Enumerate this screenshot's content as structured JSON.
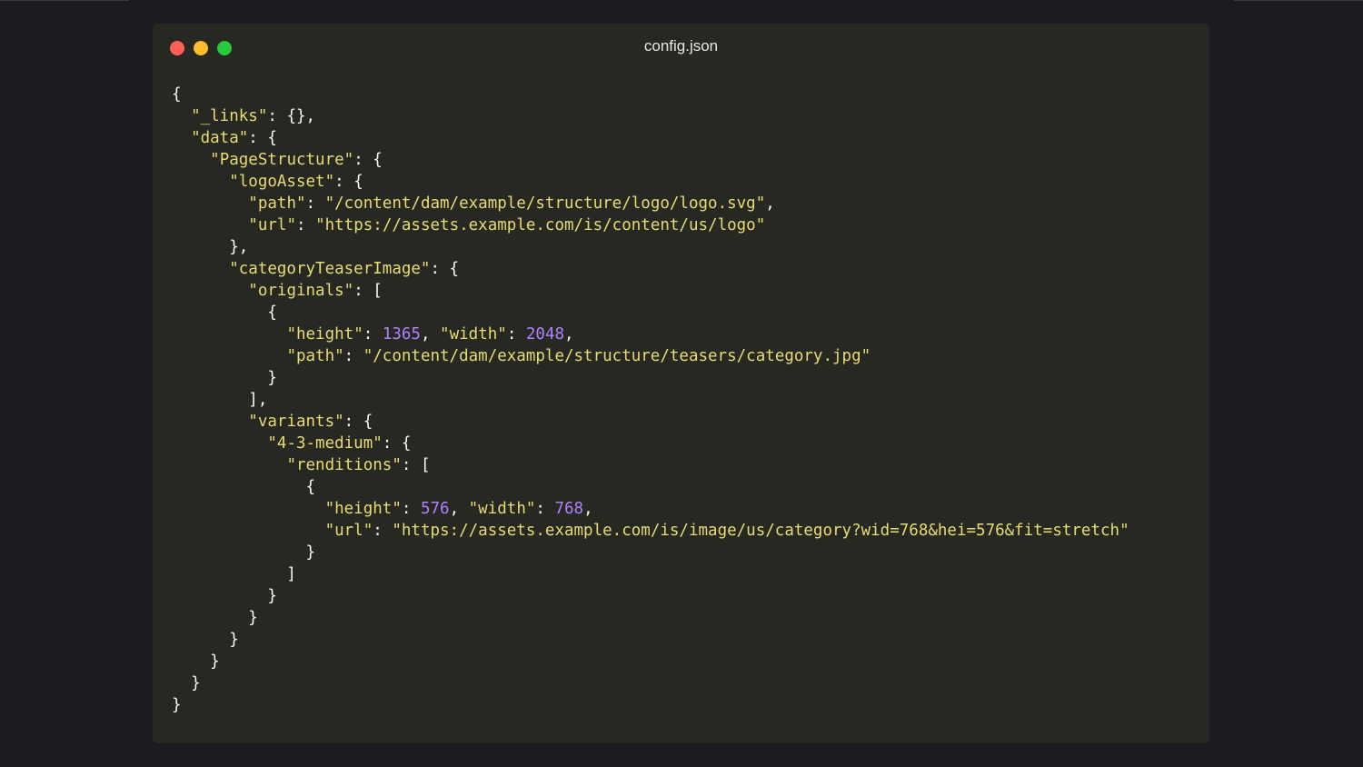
{
  "window": {
    "title": "config.json",
    "buttons": [
      "close",
      "minimize",
      "zoom"
    ]
  },
  "colors": {
    "background": "#1b1c20",
    "editor_background": "#272822",
    "text": "#f8f8f2",
    "string": "#e6db74",
    "number": "#ae81ff",
    "close": "#ff5f56",
    "minimize": "#ffbd2e",
    "zoom": "#27c93f"
  },
  "code": {
    "lines": [
      [
        {
          "t": "p",
          "v": "{"
        }
      ],
      [
        {
          "t": "p",
          "v": "  "
        },
        {
          "t": "k",
          "v": "\"_links\""
        },
        {
          "t": "p",
          "v": ": {},"
        }
      ],
      [
        {
          "t": "p",
          "v": "  "
        },
        {
          "t": "k",
          "v": "\"data\""
        },
        {
          "t": "p",
          "v": ": {"
        }
      ],
      [
        {
          "t": "p",
          "v": "    "
        },
        {
          "t": "k",
          "v": "\"PageStructure\""
        },
        {
          "t": "p",
          "v": ": {"
        }
      ],
      [
        {
          "t": "p",
          "v": "      "
        },
        {
          "t": "k",
          "v": "\"logoAsset\""
        },
        {
          "t": "p",
          "v": ": {"
        }
      ],
      [
        {
          "t": "p",
          "v": "        "
        },
        {
          "t": "k",
          "v": "\"path\""
        },
        {
          "t": "p",
          "v": ": "
        },
        {
          "t": "s",
          "v": "\"/content/dam/example/structure/logo/logo.svg\""
        },
        {
          "t": "p",
          "v": ","
        }
      ],
      [
        {
          "t": "p",
          "v": "        "
        },
        {
          "t": "k",
          "v": "\"url\""
        },
        {
          "t": "p",
          "v": ": "
        },
        {
          "t": "s",
          "v": "\"https://assets.example.com/is/content/us/logo\""
        }
      ],
      [
        {
          "t": "p",
          "v": "      },"
        }
      ],
      [
        {
          "t": "p",
          "v": "      "
        },
        {
          "t": "k",
          "v": "\"categoryTeaserImage\""
        },
        {
          "t": "p",
          "v": ": {"
        }
      ],
      [
        {
          "t": "p",
          "v": "        "
        },
        {
          "t": "k",
          "v": "\"originals\""
        },
        {
          "t": "p",
          "v": ": ["
        }
      ],
      [
        {
          "t": "p",
          "v": "          {"
        }
      ],
      [
        {
          "t": "p",
          "v": "            "
        },
        {
          "t": "k",
          "v": "\"height\""
        },
        {
          "t": "p",
          "v": ": "
        },
        {
          "t": "n",
          "v": "1365"
        },
        {
          "t": "p",
          "v": ", "
        },
        {
          "t": "k",
          "v": "\"width\""
        },
        {
          "t": "p",
          "v": ": "
        },
        {
          "t": "n",
          "v": "2048"
        },
        {
          "t": "p",
          "v": ","
        }
      ],
      [
        {
          "t": "p",
          "v": "            "
        },
        {
          "t": "k",
          "v": "\"path\""
        },
        {
          "t": "p",
          "v": ": "
        },
        {
          "t": "s",
          "v": "\"/content/dam/example/structure/teasers/category.jpg\""
        }
      ],
      [
        {
          "t": "p",
          "v": "          }"
        }
      ],
      [
        {
          "t": "p",
          "v": "        ],"
        }
      ],
      [
        {
          "t": "p",
          "v": "        "
        },
        {
          "t": "k",
          "v": "\"variants\""
        },
        {
          "t": "p",
          "v": ": {"
        }
      ],
      [
        {
          "t": "p",
          "v": "          "
        },
        {
          "t": "k",
          "v": "\"4-3-medium\""
        },
        {
          "t": "p",
          "v": ": {"
        }
      ],
      [
        {
          "t": "p",
          "v": "            "
        },
        {
          "t": "k",
          "v": "\"renditions\""
        },
        {
          "t": "p",
          "v": ": ["
        }
      ],
      [
        {
          "t": "p",
          "v": "              {"
        }
      ],
      [
        {
          "t": "p",
          "v": "                "
        },
        {
          "t": "k",
          "v": "\"height\""
        },
        {
          "t": "p",
          "v": ": "
        },
        {
          "t": "n",
          "v": "576"
        },
        {
          "t": "p",
          "v": ", "
        },
        {
          "t": "k",
          "v": "\"width\""
        },
        {
          "t": "p",
          "v": ": "
        },
        {
          "t": "n",
          "v": "768"
        },
        {
          "t": "p",
          "v": ","
        }
      ],
      [
        {
          "t": "p",
          "v": "                "
        },
        {
          "t": "k",
          "v": "\"url\""
        },
        {
          "t": "p",
          "v": ": "
        },
        {
          "t": "s",
          "v": "\"https://assets.example.com/is/image/us/category?wid=768&hei=576&fit=stretch\""
        }
      ],
      [
        {
          "t": "p",
          "v": "              }"
        }
      ],
      [
        {
          "t": "p",
          "v": "            ]"
        }
      ],
      [
        {
          "t": "p",
          "v": "          }"
        }
      ],
      [
        {
          "t": "p",
          "v": "        }"
        }
      ],
      [
        {
          "t": "p",
          "v": "      }"
        }
      ],
      [
        {
          "t": "p",
          "v": "    }"
        }
      ],
      [
        {
          "t": "p",
          "v": "  }"
        }
      ],
      [
        {
          "t": "p",
          "v": "}"
        }
      ]
    ]
  }
}
